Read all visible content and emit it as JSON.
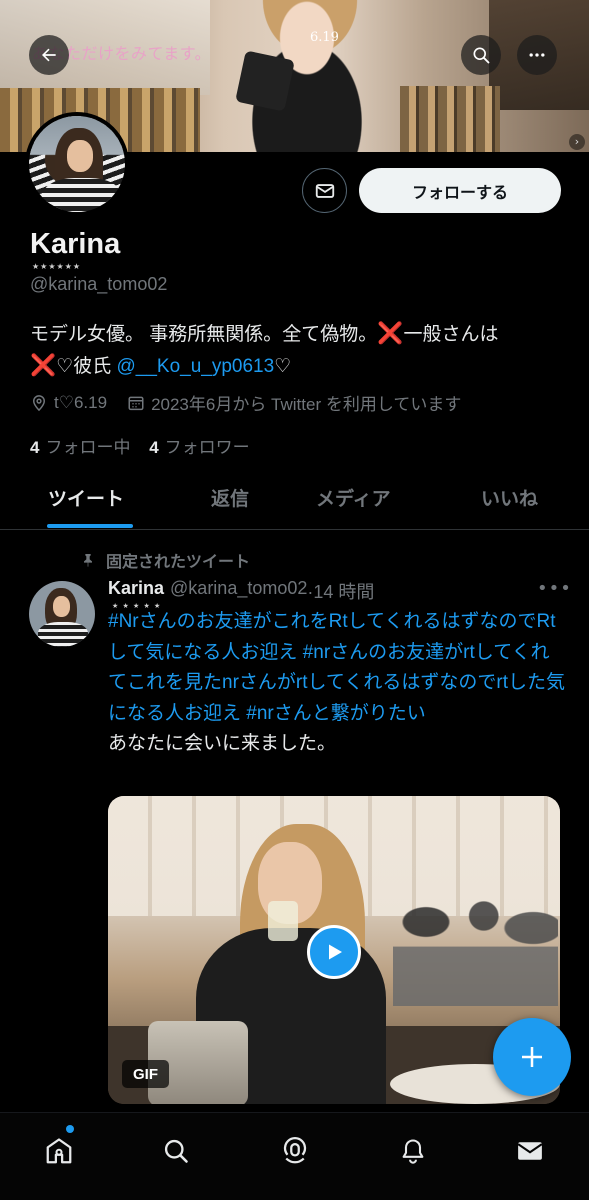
{
  "banner": {
    "overlay_text": "あなただけをみてます。",
    "date_text": "6.19"
  },
  "profile": {
    "display_name": "Karina",
    "name_decoration": "★★★★★★",
    "handle": "@karina_tomo02",
    "follow_label": "フォローする",
    "bio_line1_a": "モデル女優。 事務所無関係。全て偽物。",
    "bio_cross": "❌",
    "bio_line1_b": "一般さんは",
    "bio_line2_a": "♡彼氏 ",
    "bio_mention": "@__Ko_u_yp0613",
    "bio_line2_b": "♡",
    "location": "t♡6.19",
    "joined": "2023年6月から Twitter を利用しています",
    "following_count": "4",
    "following_label": "フォロー中",
    "followers_count": "4",
    "followers_label": "フォロワー"
  },
  "tabs": [
    "ツイート",
    "返信",
    "メディア",
    "いいね"
  ],
  "pinned_tweet": {
    "pinned_label": "固定されたツイート",
    "author_name": "Karina",
    "author_decoration": "★ ★ ★ ★ ★",
    "author_handle": "@karina_tomo02",
    "time": "·14 時間",
    "more": "•••",
    "tags_text": "#Nrさんのお友達がこれをRtしてくれるはずなのでRtして気になる人お迎え #nrさんのお友達がrtしてくれてこれを見たnrさんがrtしてくれるはずなのでrtした気になる人お迎え #nrさんと繋がりたい",
    "body_text": "あなたに会いに来ました。",
    "media_badge": "GIF"
  },
  "colors": {
    "accent": "#1d9bf0",
    "background": "#000000",
    "secondary_text": "#71767b",
    "cross": "#e0245e"
  },
  "icons": {
    "back": "arrow-left-icon",
    "search": "search-icon",
    "more": "more-horizontal-icon",
    "message": "envelope-icon",
    "location": "location-pin-icon",
    "calendar": "calendar-icon",
    "pin": "pin-icon",
    "play": "play-icon",
    "compose": "plus-icon",
    "nav": [
      "home-icon",
      "search-icon",
      "spaces-icon",
      "bell-icon",
      "mail-icon"
    ]
  }
}
